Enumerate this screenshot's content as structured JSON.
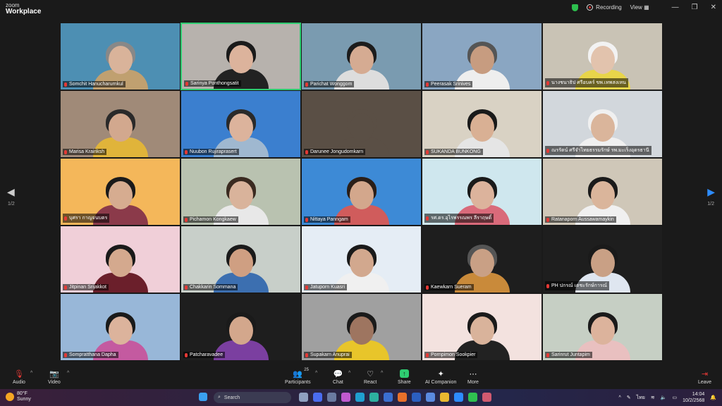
{
  "app": {
    "logo_line1": "zoom",
    "logo_line2": "Workplace"
  },
  "top_bar": {
    "recording_label": "Recording",
    "view_label": "View",
    "minimize": "—",
    "maximize": "❐",
    "close": "✕"
  },
  "pagination": {
    "left": "1/2",
    "right": "1/2"
  },
  "participants": [
    {
      "name": "Somchit Hanucharurnkul",
      "bg": "#4d8fb3",
      "skin": "#d9b39a",
      "hair": "#888",
      "shirt": "#c0a070",
      "active": false
    },
    {
      "name": "Sarinya Ponthongsatit",
      "bg": "#b7b2ad",
      "skin": "#dcb39c",
      "hair": "#1a1a1a",
      "shirt": "#222",
      "active": true
    },
    {
      "name": "Parichat Wonggom",
      "bg": "#7a9bb0",
      "skin": "#d5ab92",
      "hair": "#1c1c1c",
      "shirt": "#ddd",
      "active": false
    },
    {
      "name": "Peerasak  Srinives",
      "bg": "#8aa6c2",
      "skin": "#c79c80",
      "hair": "#555",
      "shirt": "#eee",
      "active": false
    },
    {
      "name": "นางชนาธิป ศรีอบคร์ ขพ.เทพสงเหน",
      "bg": "#c9c3b5",
      "skin": "#e2c3ad",
      "hair": "#f2f2f2",
      "shirt": "#e8d54a",
      "active": false
    },
    {
      "name": "Marisa Krairiksh",
      "bg": "#a08a78",
      "skin": "#d2a88e",
      "hair": "#2a2a2a",
      "shirt": "#e0b43a",
      "active": false
    },
    {
      "name": "Nuubon Rujiraprasert",
      "bg": "#3b7fcf",
      "skin": "#dcb39c",
      "hair": "#2a2a2a",
      "shirt": "#9fb8d0",
      "active": false
    },
    {
      "name": "Darunee Jongudomkarn",
      "bg": "#5a4f45",
      "skin": "#5a4f45",
      "hair": "#5a4f45",
      "shirt": "#5a4f45",
      "active": false
    },
    {
      "name": "SUKANDA BUNKONG",
      "bg": "#d9d2c4",
      "skin": "#d9b094",
      "hair": "#1a1a1a",
      "shirt": "#e5e5e5",
      "active": false
    },
    {
      "name": "ณรรัตน์  ศรีจำไทยธรรมรักษ์ รพ.มะเร็งอุดรธานี",
      "bg": "#d2d7dc",
      "skin": "#dab59b",
      "hair": "#f0f0f0",
      "shirt": "#f0f0f0",
      "active": false
    },
    {
      "name": "บุศรา  กาญจนบตร",
      "bg": "#f4b75a",
      "skin": "#d6ac90",
      "hair": "#1a1a1a",
      "shirt": "#8b3a4a",
      "active": false
    },
    {
      "name": "Pichamon Kongkaew",
      "bg": "#b9c2b0",
      "skin": "#d9b39b",
      "hair": "#3a2a20",
      "shirt": "#e8e8e8",
      "active": false
    },
    {
      "name": "Nittaya Panngam",
      "bg": "#3d8ad6",
      "skin": "#d3a78c",
      "hair": "#2a1e18",
      "shirt": "#d05c5c",
      "active": false
    },
    {
      "name": "รศ.ดร.อุไรพรรณพร ลีราฤษดิ์",
      "bg": "#cfe7ee",
      "skin": "#dcb39c",
      "hair": "#1a1a1a",
      "shirt": "#d96a7a",
      "active": false
    },
    {
      "name": "Ratanaporn Aussawamaykin",
      "bg": "#cfc7b8",
      "skin": "#dab59b",
      "hair": "#1a1a1a",
      "shirt": "#f0f0f0",
      "active": false
    },
    {
      "name": "Jitpinan Srijakkot",
      "bg": "#f0cfd8",
      "skin": "#d4a98e",
      "hair": "#1a1a1a",
      "shirt": "#6b1f2b",
      "active": false
    },
    {
      "name": "Chakkarin Sommana",
      "bg": "#c8cfc9",
      "skin": "#cf9f82",
      "hair": "#1a1a1a",
      "shirt": "#3c6fb0",
      "active": false
    },
    {
      "name": "Jatuporn Kuasri",
      "bg": "#e5edf5",
      "skin": "#d2a88e",
      "hair": "#1a1a1a",
      "shirt": "#f0f0f0",
      "active": false
    },
    {
      "name": "Kaewkarn Sueram",
      "bg": "#1e1e1e",
      "skin": "#c9a085",
      "hair": "#555",
      "shirt": "#c98a3a",
      "active": false
    },
    {
      "name": "PH ปกรณ์ เตชะรักษ์การณ์",
      "bg": "#1e1e1e",
      "skin": "#c9a085",
      "hair": "#1a1a1a",
      "shirt": "#dfe6f0",
      "active": false
    },
    {
      "name": "Sompratthana Dapha",
      "bg": "#98b7d8",
      "skin": "#dcb39c",
      "hair": "#1a1a1a",
      "shirt": "#c45aa0",
      "active": false
    },
    {
      "name": "Patcharavadee",
      "bg": "#1e1e1e",
      "skin": "#d3a78c",
      "hair": "#1a1a1a",
      "shirt": "#7b3fa0",
      "active": false
    },
    {
      "name": "Supakarn Anuprai",
      "bg": "#a0a0a0",
      "skin": "#9e7560",
      "hair": "#1a1a1a",
      "shirt": "#e8c52a",
      "active": false
    },
    {
      "name": "Pornpimon Sookpier",
      "bg": "#f3e2df",
      "skin": "#d9b39b",
      "hair": "#1a1a1a",
      "shirt": "#222",
      "active": false
    },
    {
      "name": "Sarinrut Juntapim",
      "bg": "#c6cfc4",
      "skin": "#dcb39c",
      "hair": "#1a1a1a",
      "shirt": "#e9c0c0",
      "active": false
    }
  ],
  "toolbar": {
    "audio": "Audio",
    "video": "Video",
    "participants": "Participants",
    "participants_count": "25",
    "chat": "Chat",
    "react": "React",
    "share": "Share",
    "ai_companion": "AI Companion",
    "more": "More",
    "leave": "Leave"
  },
  "taskbar": {
    "temperature": "80°F",
    "condition": "Sunny",
    "search_placeholder": "Search",
    "language": "ไทย",
    "time": "14:04",
    "date": "10/2/2568"
  }
}
